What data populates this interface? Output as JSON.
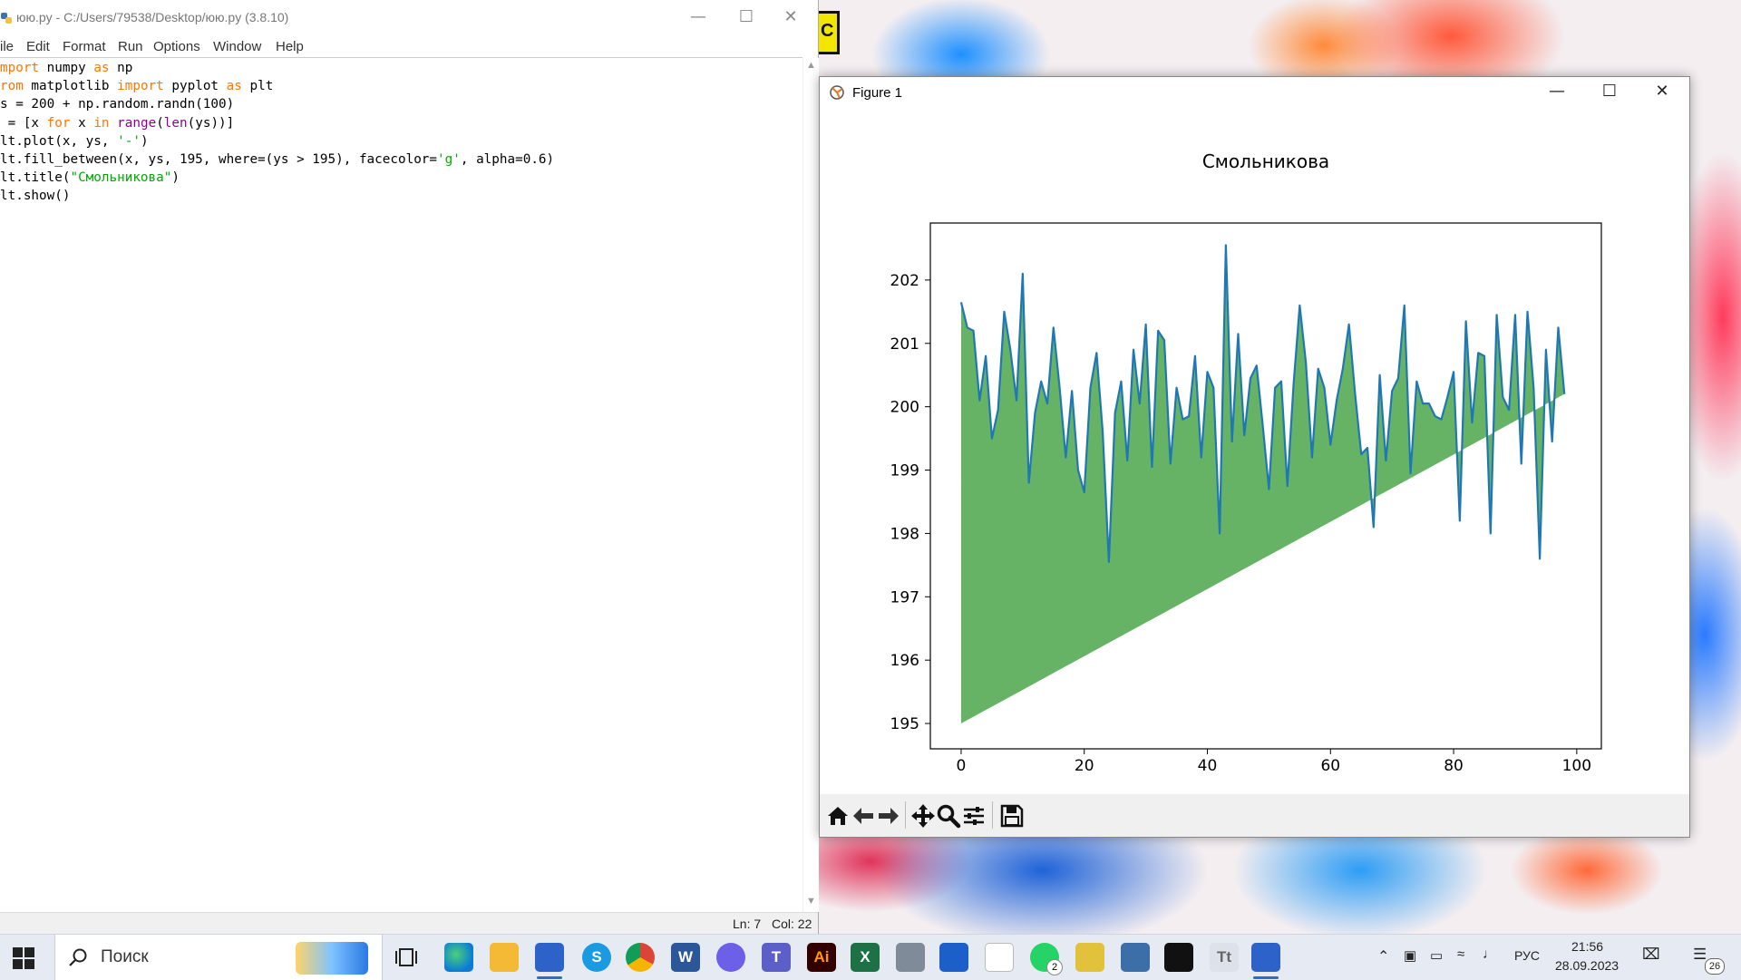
{
  "idle": {
    "title": "юю.py - C:/Users/79538/Desktop/юю.py (3.8.10)",
    "menu": [
      "ile",
      "Edit",
      "Format",
      "Run",
      "Options",
      "Window",
      "Help"
    ],
    "code_lines": [
      [
        {
          "t": "mport",
          "c": "kw"
        },
        {
          "t": " numpy ",
          "c": ""
        },
        {
          "t": "as",
          "c": "kw"
        },
        {
          "t": " np",
          "c": ""
        }
      ],
      [
        {
          "t": "rom",
          "c": "kw"
        },
        {
          "t": " matplotlib ",
          "c": ""
        },
        {
          "t": "import",
          "c": "kw"
        },
        {
          "t": " pyplot ",
          "c": ""
        },
        {
          "t": "as",
          "c": "kw"
        },
        {
          "t": " plt",
          "c": ""
        }
      ],
      [
        {
          "t": "s = 200 + np.random.randn(100)",
          "c": ""
        }
      ],
      [
        {
          "t": " = [x ",
          "c": ""
        },
        {
          "t": "for",
          "c": "kw"
        },
        {
          "t": " x ",
          "c": ""
        },
        {
          "t": "in",
          "c": "kw"
        },
        {
          "t": " ",
          "c": ""
        },
        {
          "t": "range",
          "c": "bi"
        },
        {
          "t": "(",
          "c": ""
        },
        {
          "t": "len",
          "c": "bi"
        },
        {
          "t": "(ys))]",
          "c": ""
        }
      ],
      [
        {
          "t": "lt.plot(x, ys, ",
          "c": ""
        },
        {
          "t": "'-'",
          "c": "str"
        },
        {
          "t": ")",
          "c": ""
        }
      ],
      [
        {
          "t": "lt.fill_between(x, ys, 195, where=(ys > 195), facecolor=",
          "c": ""
        },
        {
          "t": "'g'",
          "c": "str"
        },
        {
          "t": ", alpha=0.6)",
          "c": ""
        }
      ],
      [
        {
          "t": "lt.title(",
          "c": ""
        },
        {
          "t": "\"Смольникова\"",
          "c": "str"
        },
        {
          "t": ")",
          "c": ""
        }
      ],
      [
        {
          "t": "lt.show()",
          "c": ""
        }
      ]
    ],
    "status_ln": "Ln: 7",
    "status_col": "Col: 22"
  },
  "figure": {
    "window_title": "Figure 1",
    "toolbar_icons": [
      "home-icon",
      "back-icon",
      "forward-icon",
      "pan-icon",
      "zoom-icon",
      "configure-icon",
      "save-icon"
    ]
  },
  "chart_data": {
    "type": "area",
    "title": "Смольникова",
    "xlabel": "",
    "ylabel": "",
    "xlim": [
      -5,
      104
    ],
    "ylim": [
      194.6,
      202.9
    ],
    "xticks": [
      0,
      20,
      40,
      60,
      80,
      100
    ],
    "yticks": [
      195,
      196,
      197,
      198,
      199,
      200,
      201,
      202
    ],
    "fill_baseline": 195,
    "line_color": "#1f77b4",
    "fill_color": "#008000",
    "fill_alpha": 0.6,
    "x": [
      0,
      1,
      2,
      3,
      4,
      5,
      6,
      7,
      8,
      9,
      10,
      11,
      12,
      13,
      14,
      15,
      16,
      17,
      18,
      19,
      20,
      21,
      22,
      23,
      24,
      25,
      26,
      27,
      28,
      29,
      30,
      31,
      32,
      33,
      34,
      35,
      36,
      37,
      38,
      39,
      40,
      41,
      42,
      43,
      44,
      45,
      46,
      47,
      48,
      49,
      50,
      51,
      52,
      53,
      54,
      55,
      56,
      57,
      58,
      59,
      60,
      61,
      62,
      63,
      64,
      65,
      66,
      67,
      68,
      69,
      70,
      71,
      72,
      73,
      74,
      75,
      76,
      77,
      78,
      79,
      80,
      81,
      82,
      83,
      84,
      85,
      86,
      87,
      88,
      89,
      90,
      91,
      92,
      93,
      94,
      95,
      96,
      97,
      98,
      99
    ],
    "y": [
      201.65,
      201.25,
      201.2,
      200.1,
      200.8,
      199.5,
      199.95,
      201.5,
      200.9,
      200.1,
      202.1,
      198.8,
      199.9,
      200.4,
      200.05,
      201.25,
      200.3,
      199.2,
      200.25,
      199.0,
      198.65,
      200.3,
      200.85,
      199.6,
      197.55,
      199.9,
      200.4,
      199.15,
      200.9,
      200.05,
      201.3,
      199.05,
      201.2,
      201.05,
      199.1,
      200.3,
      199.8,
      199.85,
      200.8,
      199.2,
      200.55,
      200.3,
      198.0,
      202.55,
      199.45,
      201.15,
      199.55,
      200.45,
      200.65,
      199.7,
      198.7,
      200.3,
      200.4,
      198.75,
      200.35,
      201.6,
      200.7,
      199.2,
      200.6,
      200.3,
      199.4,
      200.1,
      200.6,
      201.3,
      200.2,
      199.25,
      199.35,
      198.1,
      200.5,
      199.15,
      200.25,
      200.45,
      201.6,
      198.95,
      200.4,
      200.05,
      200.05,
      199.85,
      199.8,
      200.15,
      200.55,
      198.2,
      201.35,
      199.75,
      200.85,
      200.8,
      198.0,
      201.45,
      200.15,
      199.95,
      201.45,
      199.1,
      201.5,
      200.3,
      197.6,
      200.9,
      199.45,
      201.25,
      200.2
    ]
  },
  "taskbar": {
    "search_placeholder": "Поиск",
    "tray_lang": "РУС",
    "time": "21:56",
    "date": "28.09.2023",
    "notification_count": "26",
    "whatsapp_badge": "2"
  }
}
